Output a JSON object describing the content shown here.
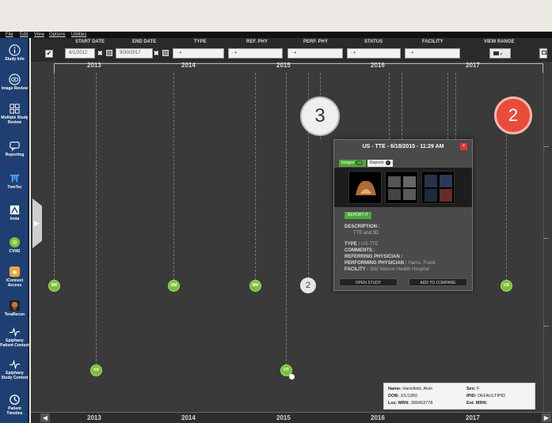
{
  "menu": {
    "file": "File",
    "edit": "Edit",
    "view": "View",
    "options": "Options",
    "utilities": "Utilities"
  },
  "sidebar": {
    "items": [
      {
        "label": "Study Info",
        "icon": "info-icon"
      },
      {
        "label": "Image Review",
        "icon": "eye-icon"
      },
      {
        "label": "Multiple Study Review",
        "icon": "grid-icon"
      },
      {
        "label": "Reporting",
        "icon": "chat-icon"
      },
      {
        "label": "TomTec",
        "icon": "tomtec-logo-icon"
      },
      {
        "label": "Invia",
        "icon": "invia-icon"
      },
      {
        "label": "CVI42",
        "icon": "cvi42-icon"
      },
      {
        "label": "iConnect Access",
        "icon": "iconnect-icon"
      },
      {
        "label": "TeraRecon",
        "icon": "terarecon-icon"
      },
      {
        "label": "Epiphany Patient Context",
        "icon": "pulse-icon"
      },
      {
        "label": "Epiphany Study Context",
        "icon": "pulse-icon"
      },
      {
        "label": "Patient Timeline",
        "icon": "history-icon"
      }
    ]
  },
  "filters": {
    "start_date_label": "START DATE",
    "start_date_value": "8/1/2012",
    "end_date_label": "END DATE",
    "end_date_value": "9/30/2017",
    "type_label": "TYPE",
    "ref_phy_label": "REF. PHY",
    "perf_phy_label": "PERF. PHY",
    "status_label": "STATUS",
    "facility_label": "FACILITY",
    "view_range_label": "VIEW RANGE",
    "dropdown_placeholder": "-",
    "check_mark": "✔"
  },
  "years": [
    "2013",
    "2014",
    "2015",
    "2016",
    "2017"
  ],
  "nodes": [
    {
      "label": "MR"
    },
    {
      "label": "NM"
    },
    {
      "label": "NM"
    },
    {
      "label": "US"
    },
    {
      "label": "XA"
    },
    {
      "label": "OT"
    }
  ],
  "badges": {
    "grey": "2",
    "three": "3",
    "red": "2"
  },
  "popup": {
    "title": "US - TTE - 6/18/2015 - 11:29 AM",
    "close": "×",
    "tab_images": "Images",
    "tab_images_count": "40",
    "tab_reports": "Reports",
    "tab_reports_count": "1",
    "report_button": "REPORT IT",
    "description_label": "DESCRIPTION :",
    "description_value": "TTE and 3D",
    "type_label": "TYPE :",
    "type_value": "US-TTE",
    "comments_label": "COMMENTS :",
    "ref_phy_label": "REFERRING PHYSICIAN :",
    "perf_phy_label": "PERFORMING PHYSICIAN :",
    "perf_phy_value": "Harris, Frank",
    "facility_label": "FACILITY :",
    "facility_value": "IBM Watson Health Hospital",
    "open_study": "OPEN STUDY",
    "add_to_compare": "ADD TO COMPARE"
  },
  "patient": {
    "name_label": "Name:",
    "name_value": "Hartsfield, Alvin",
    "dob_label": "DOB:",
    "dob_value": "1/1/1950",
    "loc_mrn_label": "Loc. MRN:",
    "loc_mrn_value": "396453778",
    "sex_label": "Sex:",
    "sex_value": "F",
    "ipid_label": "IPID:",
    "ipid_value": "DEFAULTIPID",
    "ent_mrn_label": "Ent. MRN:",
    "ent_mrn_value": ""
  },
  "colors": {
    "sidebar": "#1f3f72",
    "node": "#7bbf3a",
    "badge_red": "#e74c3c"
  }
}
